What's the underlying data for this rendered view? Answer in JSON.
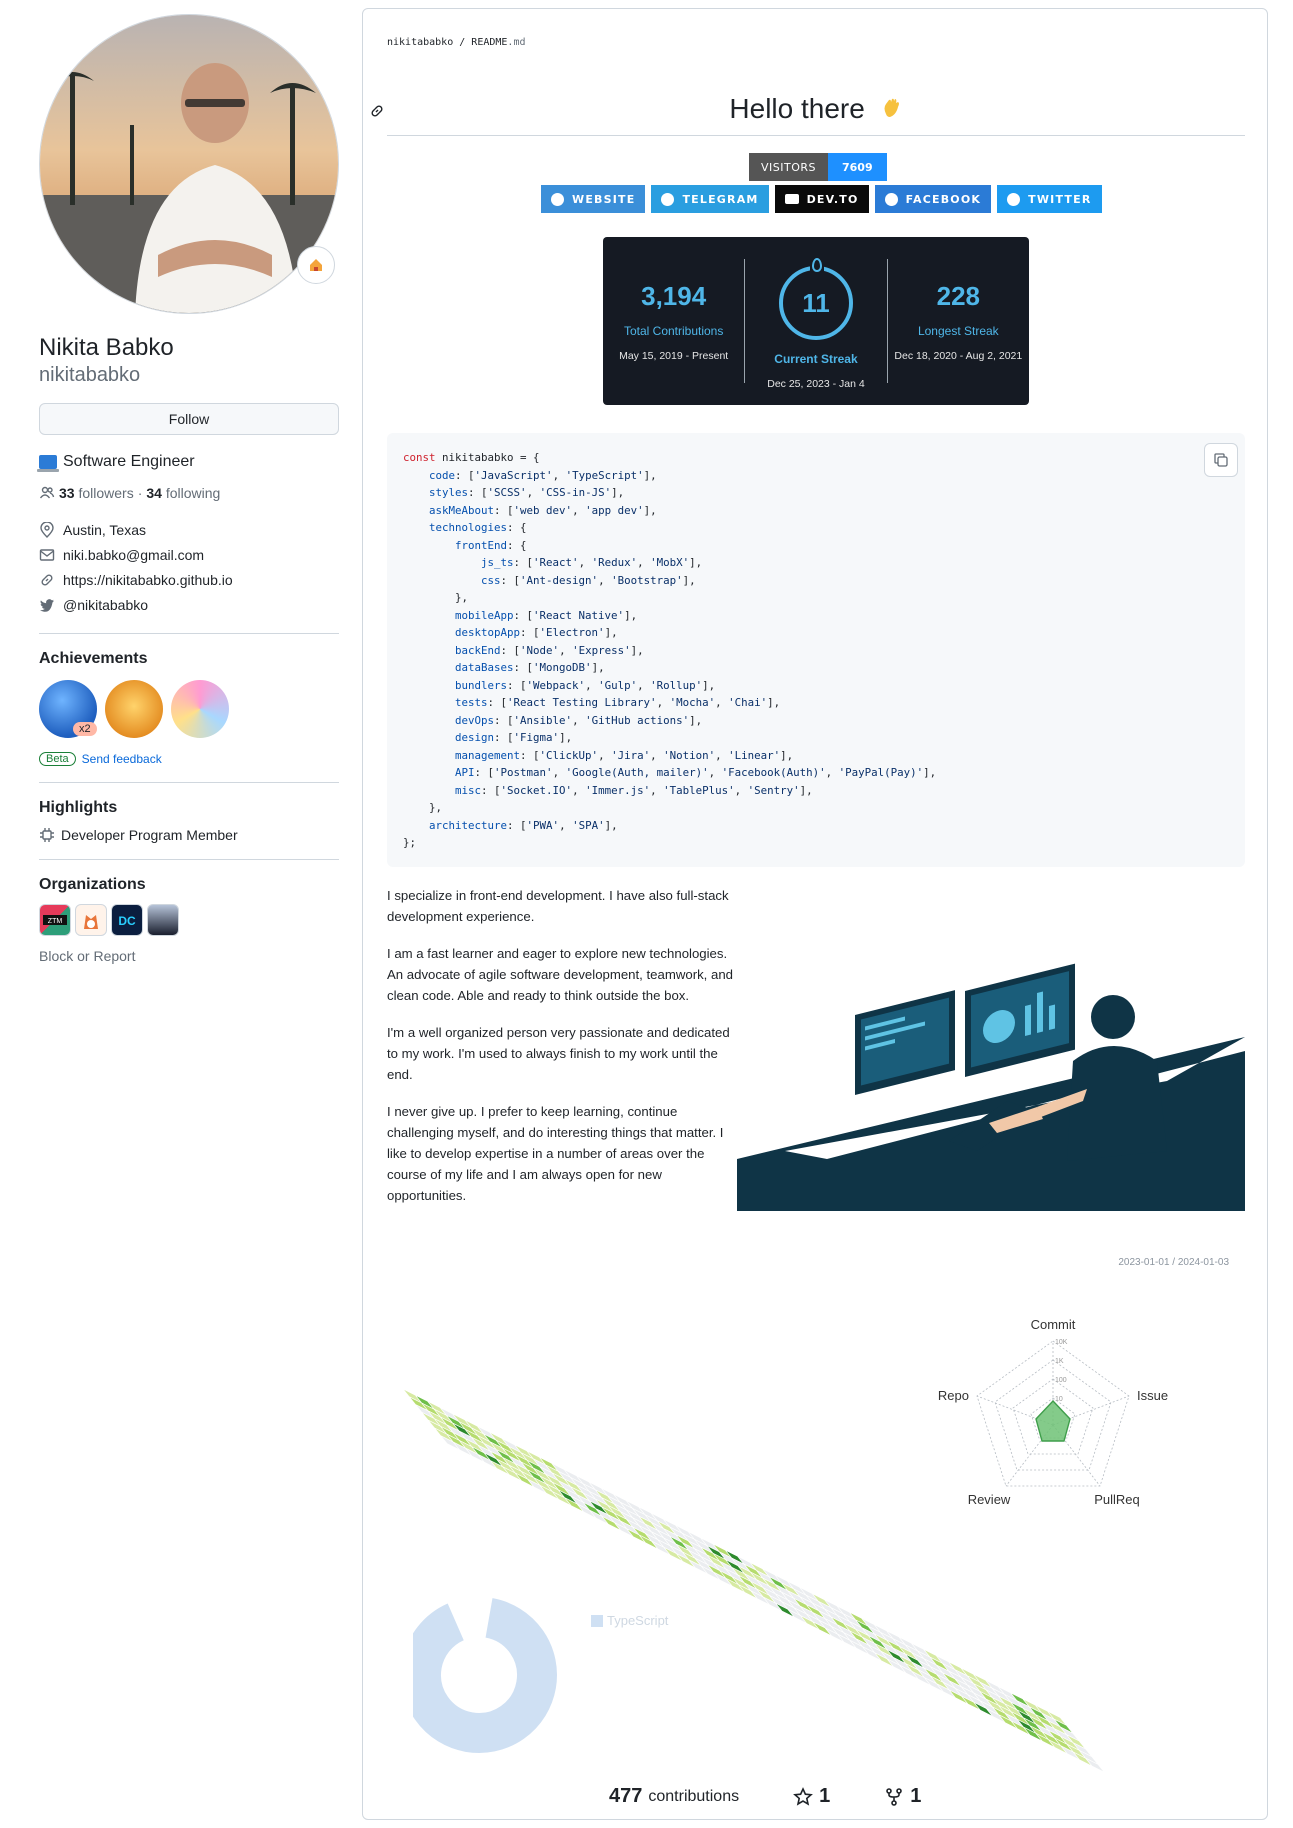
{
  "profile": {
    "full_name": "Nikita Babko",
    "username": "nikitababko",
    "follow_label": "Follow",
    "bio": "Software Engineer",
    "followers_count": "33",
    "followers_label": "followers",
    "following_count": "34",
    "following_label": "following",
    "location": "Austin, Texas",
    "email": "niki.babko@gmail.com",
    "website": "https://nikitababko.github.io",
    "twitter": "@nikitababko"
  },
  "achievements": {
    "title": "Achievements",
    "multiplier": "x2",
    "beta_label": "Beta",
    "feedback_label": "Send feedback"
  },
  "highlights": {
    "title": "Highlights",
    "item": "Developer Program Member"
  },
  "organizations": {
    "title": "Organizations",
    "org_labels": [
      "ZTM",
      "DC"
    ],
    "block_label": "Block or Report"
  },
  "readme": {
    "breadcrumb_user": "nikitababko",
    "breadcrumb_sep": " / ",
    "breadcrumb_file": "README",
    "breadcrumb_ext": ".md",
    "heading": "Hello there",
    "visitors_label": "VISITORS",
    "visitors_count": "7609",
    "socials": [
      "WEBSITE",
      "TELEGRAM",
      "DEV.TO",
      "FACEBOOK",
      "TWITTER"
    ],
    "streak": {
      "total_value": "3,194",
      "total_label": "Total Contributions",
      "total_range": "May 15, 2019 - Present",
      "current_value": "11",
      "current_label": "Current Streak",
      "current_range": "Dec 25, 2023 - Jan 4",
      "longest_value": "228",
      "longest_label": "Longest Streak",
      "longest_range": "Dec 18, 2020 - Aug 2, 2021"
    },
    "about": [
      "I specialize in front-end development. I have also full-stack development experience.",
      "I am a fast learner and eager to explore new technologies. An advocate of agile software development, teamwork, and clean code. Able and ready to think outside the box.",
      "I'm a well organized person very passionate and dedicated to my work. I'm used to always finish to my work until the end.",
      "I never give up. I prefer to keep learning, continue challenging myself, and do interesting things that matter. I like to develop expertise in a number of areas over the course of my life and I am always open for new opportunities."
    ],
    "date_range": "2023-01-01 / 2024-01-03",
    "radar_axes": [
      "Commit",
      "Issue",
      "PullReq",
      "Review",
      "Repo"
    ],
    "radar_scale": [
      "10K",
      "1K",
      "100",
      "10"
    ],
    "donut_legend": "TypeScript",
    "contributions_count": "477",
    "contributions_label": "contributions",
    "stars": "1",
    "forks": "1"
  },
  "colors": {
    "accent_blue": "#0969da",
    "streak_bg": "#151a23",
    "streak_accent": "#4fb6e8",
    "visitors_blue": "#1e90ff"
  }
}
